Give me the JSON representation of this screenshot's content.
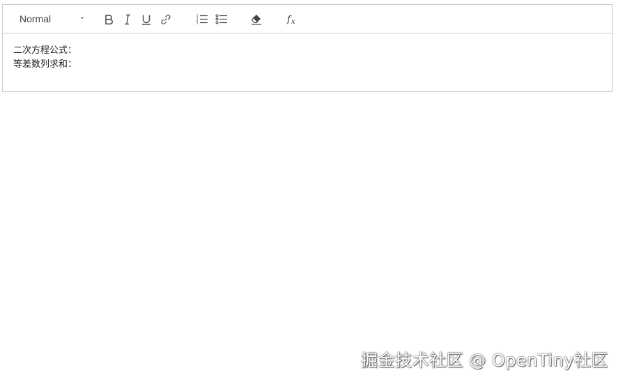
{
  "toolbar": {
    "header_select": {
      "value": "Normal"
    },
    "buttons": [
      {
        "name": "bold",
        "icon": "bold-icon"
      },
      {
        "name": "italic",
        "icon": "italic-icon"
      },
      {
        "name": "underline",
        "icon": "underline-icon"
      },
      {
        "name": "link",
        "icon": "link-icon"
      },
      {
        "name": "ordered-list",
        "icon": "ordered-list-icon"
      },
      {
        "name": "bullet-list",
        "icon": "bullet-list-icon"
      },
      {
        "name": "clean",
        "icon": "eraser-icon"
      },
      {
        "name": "formula",
        "icon": "formula-icon"
      }
    ],
    "icon_color": "#444444"
  },
  "editor": {
    "lines": [
      "二次方程公式：",
      "等差数列求和："
    ]
  },
  "watermark": {
    "text": "掘金技术社区 @ OpenTiny社区"
  },
  "colors": {
    "border": "#cccccc",
    "text": "#222222",
    "background": "#ffffff"
  }
}
